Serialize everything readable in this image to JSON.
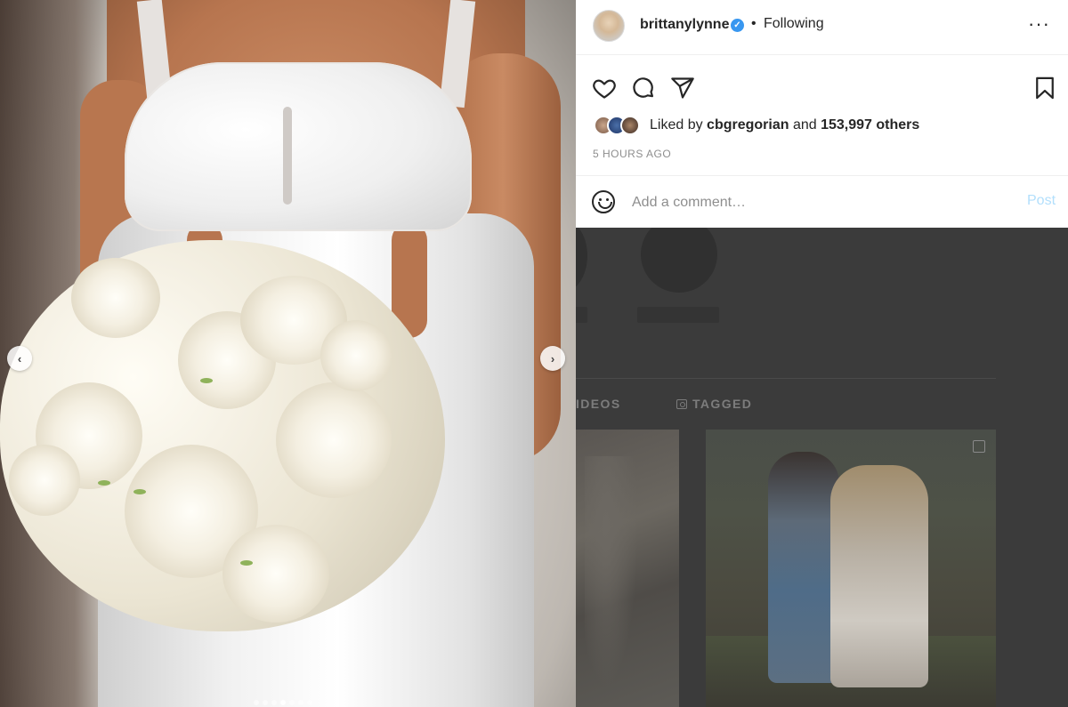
{
  "post": {
    "username": "brittanylynne",
    "follow_status": "Following",
    "bullet": "•",
    "liked_by_prefix": "Liked by ",
    "liked_by_user": "cbgregorian",
    "liked_by_and": " and ",
    "liked_by_others": "153,997 others",
    "timestamp": "5 HOURS AGO",
    "more_label": "···",
    "verified_mark": "✓"
  },
  "comment": {
    "placeholder": "Add a comment…",
    "post_label": "Post"
  },
  "carousel": {
    "prev_label": "‹",
    "next_label": "›",
    "dot_count": 7,
    "active_dot": 4
  },
  "background_profile": {
    "tabs": [
      {
        "label": "IDEOS"
      },
      {
        "label": "TAGGED"
      }
    ]
  },
  "colors": {
    "verified": "#3897f0",
    "post_button": "#b2dffc",
    "text_primary": "#262626",
    "text_secondary": "#8e8e8e"
  },
  "icons": [
    "heart-icon",
    "comment-icon",
    "share-icon",
    "bookmark-icon",
    "emoji-icon",
    "more-icon",
    "verified-icon",
    "tag-icon",
    "multi-post-icon"
  ]
}
